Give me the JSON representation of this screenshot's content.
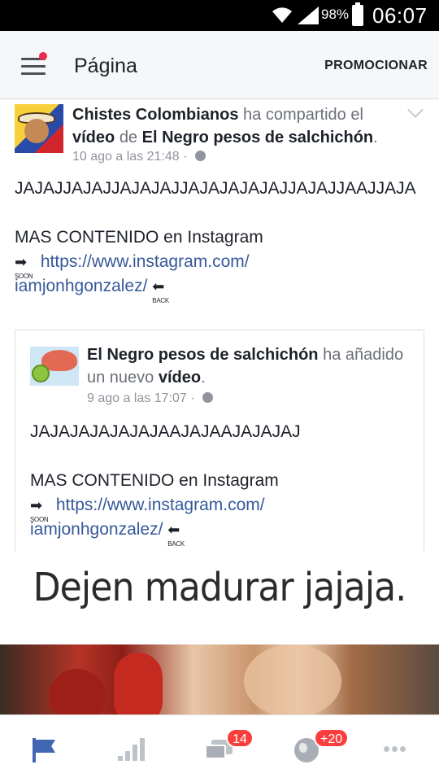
{
  "status_bar": {
    "battery": "98%",
    "time": "06:07"
  },
  "app_bar": {
    "title": "Página",
    "promote_label": "PROMOCIONAR"
  },
  "post": {
    "author": "Chistes Colombianos",
    "shared_text": "ha compartido el",
    "object": "vídeo",
    "of_text": "de",
    "source_page": "El Negro pesos de salchichón",
    "period": ".",
    "date": "10 ago a las 21:48",
    "separator": "·",
    "laugh_text": "JAJAJJAJAJJAJAJAJJAJAJAJAJAJJAJAJJAAJJAJA",
    "more_text": "MAS CONTENIDO en Instagram",
    "link_line1": "https://www.instagram.com/",
    "link_line2": "iamjonhgonzalez/",
    "soon_label": "SOON",
    "back_label": "BACK"
  },
  "shared_post": {
    "author": "El Negro pesos de salchichón",
    "action_text": "ha añadido",
    "action_text2": "un nuevo",
    "object": "vídeo",
    "period": ".",
    "date": "9 ago a las 17:07",
    "separator": "·",
    "laugh_text": "JAJAJAJAJAJAJAAJAJAAJAJAJAJ",
    "more_text": "MAS CONTENIDO en Instagram",
    "link_line1": "https://www.instagram.com/",
    "link_line2": "iamjonhgonzalez/",
    "soon_label": "SOON",
    "back_label": "BACK"
  },
  "video_caption": "Dejen madurar jajaja.",
  "tab_bar": {
    "messages_badge": "14",
    "notifications_badge": "+20"
  },
  "icons": {
    "status": [
      "wifi-icon",
      "signal-icon",
      "battery-icon"
    ],
    "app_bar": [
      "menu-icon"
    ],
    "tabs": [
      "flag-icon",
      "insights-icon",
      "messages-icon",
      "globe-icon",
      "more-icon"
    ]
  },
  "colors": {
    "link": "#365899",
    "tab_active": "#4267b2",
    "badge": "#fa3e3e"
  }
}
